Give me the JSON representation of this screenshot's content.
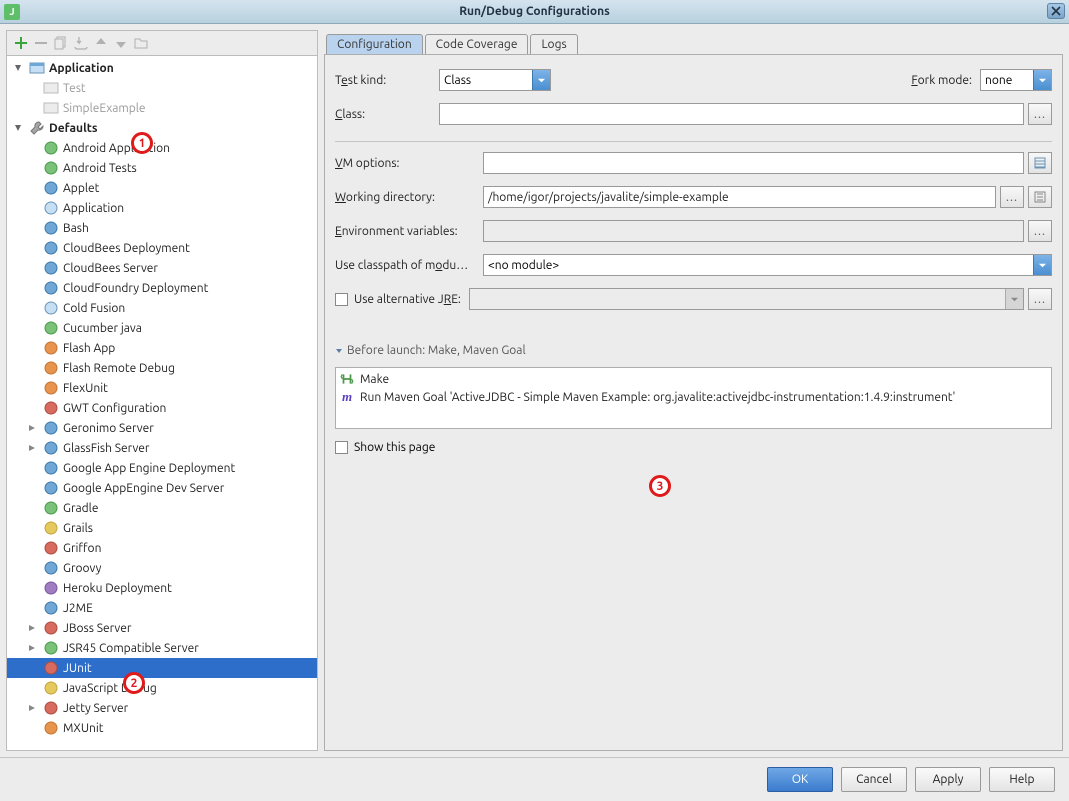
{
  "title": "Run/Debug Configurations",
  "annotations": {
    "n1": "1",
    "n2": "2",
    "n3": "3"
  },
  "tabs": {
    "configuration": "Configuration",
    "coverage": "Code Coverage",
    "logs": "Logs"
  },
  "form": {
    "test_kind_label_pre": "T",
    "test_kind_label_u": "e",
    "test_kind_label_post": "st kind:",
    "test_kind_value": "Class",
    "fork_label_u": "F",
    "fork_label_post": "ork mode:",
    "fork_value": "none",
    "class_label_u": "C",
    "class_label_post": "lass:",
    "class_value": "",
    "vm_label_u": "V",
    "vm_label_post": "M options:",
    "vm_value": "",
    "wd_label_u": "W",
    "wd_label_post": "orking directory:",
    "wd_value": "/home/igor/projects/javalite/simple-example",
    "env_label_u": "E",
    "env_label_post": "nvironment variables:",
    "env_value": "",
    "mod_label_pre": "Use classpath of m",
    "mod_label_u": "o",
    "mod_label_post": "du…",
    "mod_value": "<no module>",
    "alt_jre_pre": "Use alternative J",
    "alt_jre_u": "R",
    "alt_jre_post": "E:"
  },
  "before_launch": {
    "header": "Before launch: Make, Maven Goal",
    "items": [
      "Make",
      "Run Maven Goal 'ActiveJDBC - Simple Maven Example: org.javalite:activejdbc-instrumentation:1.4.9:instrument'"
    ]
  },
  "show_page": "Show this page",
  "buttons": {
    "ok": "OK",
    "cancel": "Cancel",
    "apply": "Apply",
    "help": "Help"
  },
  "tree": {
    "application": "Application",
    "test": "Test",
    "simple_example": "SimpleExample",
    "defaults": "Defaults",
    "items": {
      "android_app": "Android Application",
      "android_tests": "Android Tests",
      "applet": "Applet",
      "application": "Application",
      "bash": "Bash",
      "cb_deploy": "CloudBees Deployment",
      "cb_server": "CloudBees Server",
      "cf_deploy": "CloudFoundry Deployment",
      "coldfusion": "Cold Fusion",
      "cucumber": "Cucumber java",
      "flash_app": "Flash App",
      "flash_remote": "Flash Remote Debug",
      "flexunit": "FlexUnit",
      "gwt": "GWT Configuration",
      "geronimo": "Geronimo Server",
      "glassfish": "GlassFish Server",
      "gae_deploy": "Google App Engine Deployment",
      "gae_dev": "Google AppEngine Dev Server",
      "gradle": "Gradle",
      "grails": "Grails",
      "griffon": "Griffon",
      "groovy": "Groovy",
      "heroku": "Heroku Deployment",
      "j2me": "J2ME",
      "jboss": "JBoss Server",
      "jsr45": "JSR45 Compatible Server",
      "junit": "JUnit",
      "js_debug": "JavaScript Debug",
      "jetty": "Jetty Server",
      "mxunit": "MXUnit"
    }
  }
}
